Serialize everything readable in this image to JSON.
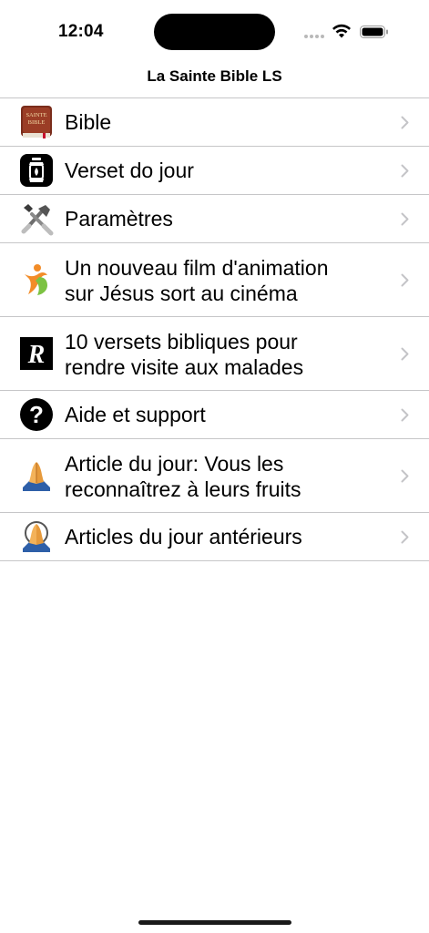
{
  "status_bar": {
    "time": "12:04"
  },
  "nav": {
    "title": "La Sainte Bible LS"
  },
  "menu": [
    {
      "label": "Bible",
      "icon": "bible-book-icon"
    },
    {
      "label": "Verset do jour",
      "icon": "lantern-icon"
    },
    {
      "label": "Paramètres",
      "icon": "tools-icon"
    },
    {
      "label_line1": "Un nouveau film d'animation",
      "label_line2": "sur Jésus sort au cinéma",
      "icon": "person-figure-icon"
    },
    {
      "label_line1": "10 versets bibliques pour",
      "label_line2": "rendre visite aux malades",
      "icon": "r-logo-icon"
    },
    {
      "label": "Aide et support",
      "icon": "question-mark-icon"
    },
    {
      "label_line1": "Article du jour: Vous les",
      "label_line2": "reconnaîtrez à leurs fruits",
      "icon": "praying-hands-icon"
    },
    {
      "label": "Articles du jour antérieurs",
      "icon": "praying-hands-clock-icon"
    }
  ]
}
